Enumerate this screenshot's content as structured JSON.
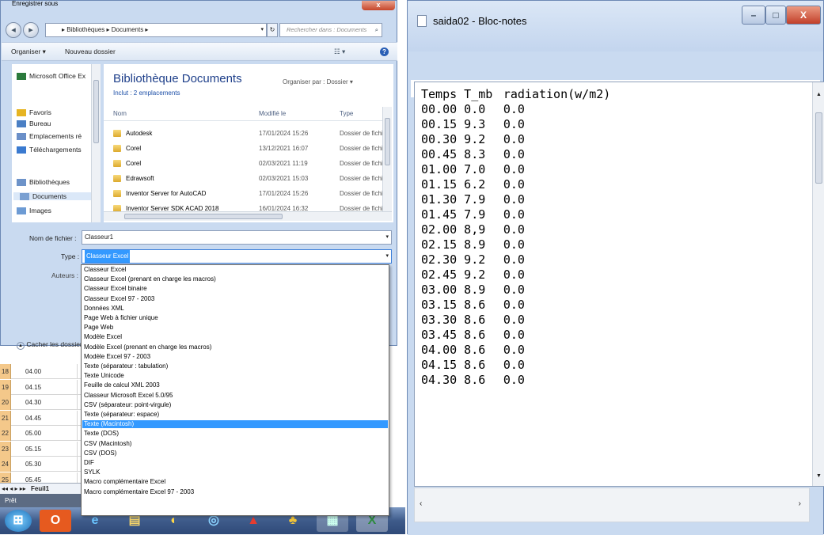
{
  "excel": {
    "rows": [
      {
        "num": "18",
        "value": "04.00"
      },
      {
        "num": "19",
        "value": "04.15"
      },
      {
        "num": "20",
        "value": "04.30"
      },
      {
        "num": "21",
        "value": "04.45"
      },
      {
        "num": "22",
        "value": "05.00"
      },
      {
        "num": "23",
        "value": "05.15"
      },
      {
        "num": "24",
        "value": "05.30"
      },
      {
        "num": "25",
        "value": "05.45"
      }
    ],
    "sheet_tab": "Feuil1",
    "status": "Prêt"
  },
  "dialog": {
    "title": "Enregistrer sous",
    "close": "x",
    "breadcrumb": "▸ Bibliothèques ▸ Documents ▸",
    "search_placeholder": "Rechercher dans : Documents",
    "toolbar": {
      "organize": "Organiser ▾",
      "new_folder": "Nouveau dossier"
    },
    "nav": [
      {
        "label": "Microsoft Office Ex",
        "icon": "excel-icon"
      },
      {
        "label": "Favoris",
        "icon": "star-icon"
      },
      {
        "label": "Bureau",
        "icon": "desktop-icon"
      },
      {
        "label": "Emplacements ré",
        "icon": "places-icon"
      },
      {
        "label": "Téléchargements",
        "icon": "download-icon"
      },
      {
        "label": "Bibliothèques",
        "icon": "library-icon"
      },
      {
        "label": "Documents",
        "icon": "document-icon"
      },
      {
        "label": "Images",
        "icon": "image-icon"
      }
    ],
    "library_title": "Bibliothèque Documents",
    "library_includes": "Inclut : 2 emplacements",
    "organize_by": "Organiser par : Dossier ▾",
    "columns": {
      "name": "Nom",
      "modified": "Modifié le",
      "type": "Type"
    },
    "files": [
      {
        "name": "Autodesk",
        "date": "17/01/2024 15:26",
        "type": "Dossier de fichiers"
      },
      {
        "name": "Corel",
        "date": "13/12/2021 16:07",
        "type": "Dossier de fichiers"
      },
      {
        "name": "Corel",
        "date": "02/03/2021 11:19",
        "type": "Dossier de fichiers"
      },
      {
        "name": "Edrawsoft",
        "date": "02/03/2021 15:03",
        "type": "Dossier de fichiers"
      },
      {
        "name": "Inventor Server for AutoCAD",
        "date": "17/01/2024 15:26",
        "type": "Dossier de fichiers"
      },
      {
        "name": "Inventor Server SDK ACAD 2018",
        "date": "16/01/2024 16:32",
        "type": "Dossier de fichiers"
      }
    ],
    "filename_label": "Nom de fichier :",
    "filename_value": "Classeur1",
    "type_label": "Type :",
    "type_value": "Classeur Excel",
    "authors_label": "Auteurs :",
    "hide_folders": "Cacher les dossier",
    "type_options": [
      "Classeur Excel",
      "Classeur Excel (prenant en charge les macros)",
      "Classeur Excel binaire",
      "Classeur Excel 97 - 2003",
      "Données XML",
      "Page Web à fichier unique",
      "Page Web",
      "Modèle Excel",
      "Modèle Excel (prenant en charge les macros)",
      "Modèle Excel 97 - 2003",
      "Texte (séparateur : tabulation)",
      "Texte Unicode",
      "Feuille de calcul XML 2003",
      "Classeur Microsoft Excel 5.0/95",
      "CSV (séparateur: point-virgule)",
      "Texte (séparateur: espace)",
      "Texte (Macintosh)",
      "Texte (DOS)",
      "CSV (Macintosh)",
      "CSV (DOS)",
      "DIF",
      "SYLK",
      "Macro complémentaire Excel",
      "Macro complémentaire Excel 97 - 2003"
    ],
    "selected_option": "Texte (Macintosh)"
  },
  "notepad": {
    "title": "saida02 - Bloc-notes",
    "menu": [
      "Fichier",
      "Edition",
      "Format",
      "Affichage",
      "?"
    ],
    "header": [
      "Temps",
      "T_mb",
      "radiation(w/m2)"
    ],
    "rows": [
      [
        "00.00",
        "0.0",
        "0.0"
      ],
      [
        "00.15",
        "9.3",
        "0.0"
      ],
      [
        "00.30",
        "9.2",
        "0.0"
      ],
      [
        "00.45",
        "8.3",
        "0.0"
      ],
      [
        "01.00",
        "7.0",
        "0.0"
      ],
      [
        "01.15",
        "6.2",
        "0.0"
      ],
      [
        "01.30",
        "7.9",
        "0.0"
      ],
      [
        "01.45",
        "7.9",
        "0.0"
      ],
      [
        "02.00",
        "8,9",
        "0.0"
      ],
      [
        "02.15",
        "8.9",
        "0.0"
      ],
      [
        "02.30",
        "9.2",
        "0.0"
      ],
      [
        "02.45",
        "9.2",
        "0.0"
      ],
      [
        "03.00",
        "8.9",
        "0.0"
      ],
      [
        "03.15",
        "8.6",
        "0.0"
      ],
      [
        "03.30",
        "8.6",
        "0.0"
      ],
      [
        "03.45",
        "8.6",
        "0.0"
      ],
      [
        "04.00",
        "8.6",
        "0.0"
      ],
      [
        "04.15",
        "8.6",
        "0.0"
      ],
      [
        "04.30",
        "8.6",
        "0.0"
      ]
    ]
  },
  "colors": {
    "selection": "#3399ff",
    "excel_row_header": "#f4c88a",
    "dialog_frame": "#c9daf0"
  }
}
